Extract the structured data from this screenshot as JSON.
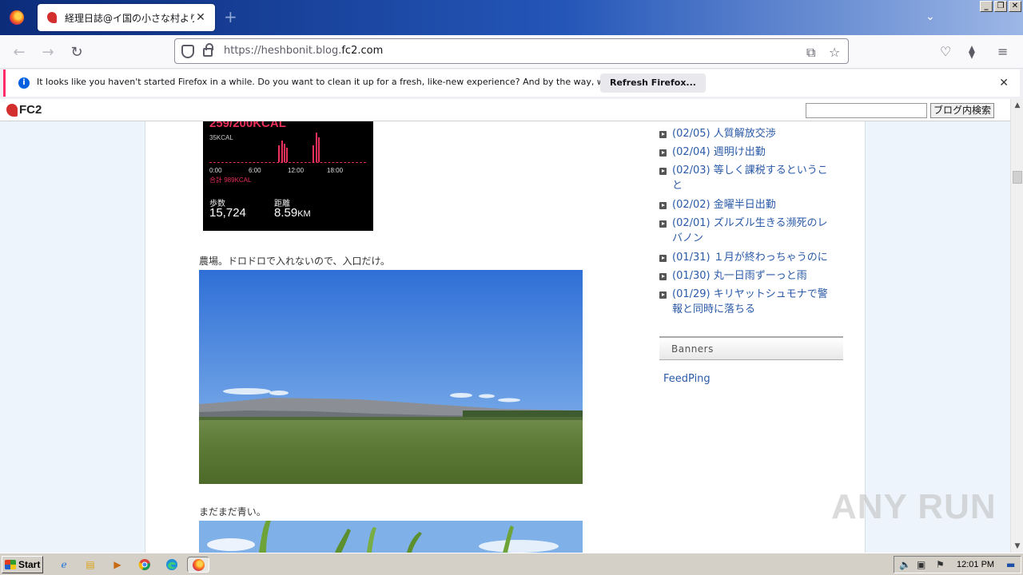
{
  "browser": {
    "tab_title": "経理日誌@イ国の小さな村より",
    "url_prefix": "https://heshbonit.blog.",
    "url_domain": "fc2.com",
    "notification_text": "It looks like you haven't started Firefox in a while. Do you want to clean it up for a fresh, like-new experience? And by the way, welcome back!",
    "refresh_button": "Refresh Firefox..."
  },
  "fc2bar": {
    "logo": "FC2",
    "search_value": "",
    "search_button": "ブログ内検索"
  },
  "post": {
    "fitness": {
      "kcal_goal": "259/200KCAL",
      "kcal_scale": "35KCAL",
      "ticks": [
        "0:00",
        "6:00",
        "12:00",
        "18:00"
      ],
      "total": "合計 989KCAL",
      "steps_label": "歩数",
      "steps_value": "15,724",
      "distance_label": "距離",
      "distance_value": "8.59",
      "distance_unit": "KM"
    },
    "caption_1": "農場。ドロドロで入れないので、入口だけ。",
    "caption_2": "まだまだ青い。"
  },
  "sidebar": {
    "recent": [
      {
        "text": "(02/05) 人質解放交渉"
      },
      {
        "text": "(02/04) 週明け出勤"
      },
      {
        "text": "(02/03) 等しく課税するということ"
      },
      {
        "text": "(02/02) 金曜半日出勤"
      },
      {
        "text": "(02/01) ズルズル生きる瀕死のレバノン"
      },
      {
        "text": "(01/31) １月が終わっちゃうのに"
      },
      {
        "text": "(01/30) 丸一日雨ずーっと雨"
      },
      {
        "text": "(01/29) キリヤットシュモナで警報と同時に落ちる"
      }
    ],
    "banners_title": "Banners",
    "feedping": "FeedPing"
  },
  "watermark": "ANY RUN",
  "taskbar": {
    "start": "Start",
    "clock": "12:01 PM"
  }
}
